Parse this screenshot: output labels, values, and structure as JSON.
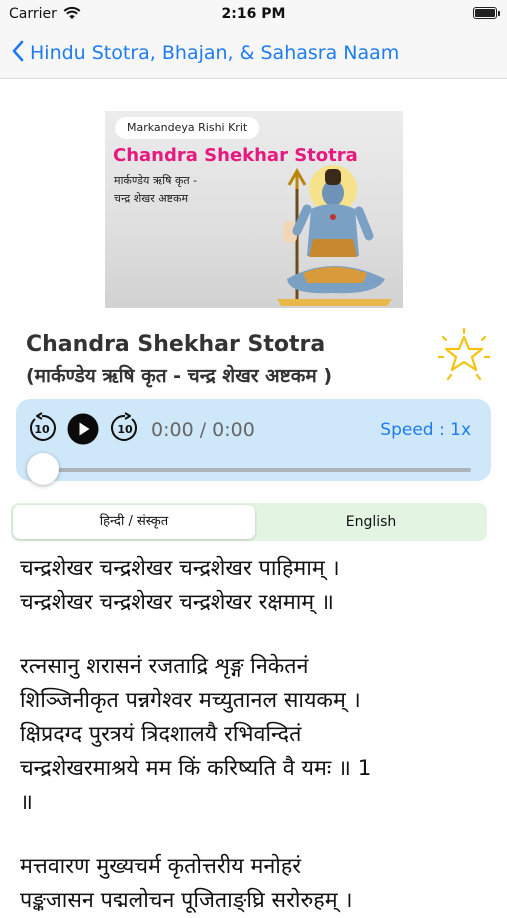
{
  "status_bar": {
    "carrier": "Carrier",
    "time": "2:16 PM",
    "battery_level": 1.0
  },
  "nav": {
    "back_label": "Hindu Stotra, Bhajan, & Sahasra Naam"
  },
  "banner": {
    "pill": "Markandeya Rishi  Krit",
    "title": "Chandra Shekhar Stotra",
    "line1": "मार्कण्डेय ऋषि कृत -",
    "line2": "चन्द्र शेखर अष्टकम"
  },
  "page": {
    "title": "Chandra Shekhar Stotra",
    "subtitle": "(मार्कण्डेय ऋषि कृत - चन्द्र शेखर अष्टकम )"
  },
  "player": {
    "time": "0:00 / 0:00",
    "speed": "Speed : 1x",
    "progress": 0,
    "skip_seconds": "10"
  },
  "segment": {
    "options": [
      "हिन्दी / संस्कृत",
      "English"
    ],
    "selected": "हिन्दी / संस्कृत"
  },
  "verses": {
    "v0": [
      "चन्द्रशेखर चन्द्रशेखर चन्द्रशेखर पाहिमाम् ।",
      "चन्द्रशेखर चन्द्रशेखर चन्द्रशेखर रक्षमाम् ॥"
    ],
    "v1": [
      "रत्नसानु शरासनं रजताद्रि शृङ्ग निकेतनं",
      "शिञ्जिनीकृत पन्नगेश्वर मच्युतानल सायकम् ।",
      "क्षिप्रदग्द पुरत्रयं त्रिदशालयै रभिवन्दितं",
      "चन्द्रशेखरमाश्रये मम किं करिष्यति वै यमः ॥ 1",
      "॥"
    ],
    "v2": [
      "मत्तवारण मुख्यचर्म कृतोत्तरीय मनोहरं",
      "पङ्कजासन पद्मलोचन पूजिताङ्घ्रि सरोरुहम् ।"
    ]
  },
  "colors": {
    "accent": "#1d7cf2",
    "banner_title": "#e5197e",
    "player_bg": "#cfe8f9",
    "segment_bg": "#e3f4e3",
    "star": "#f4c20d"
  }
}
